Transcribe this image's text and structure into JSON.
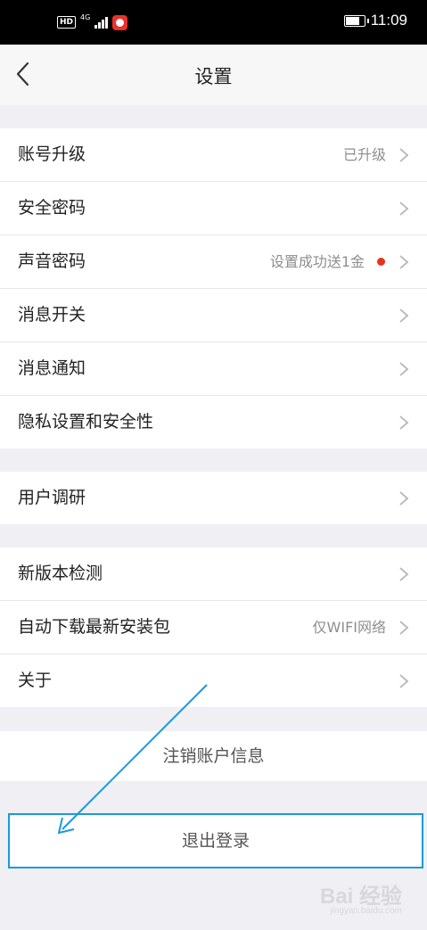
{
  "status_bar": {
    "hd": "HD",
    "network": "4G",
    "time": "11:09",
    "battery_level": 0.7
  },
  "header": {
    "title": "设置"
  },
  "groups": {
    "account": [
      {
        "label": "账号升级",
        "value": "已升级"
      },
      {
        "label": "安全密码",
        "value": ""
      },
      {
        "label": "声音密码",
        "value": "设置成功送1金",
        "has_dot": true
      },
      {
        "label": "消息开关",
        "value": ""
      },
      {
        "label": "消息通知",
        "value": ""
      },
      {
        "label": "隐私设置和安全性",
        "value": ""
      }
    ],
    "research": [
      {
        "label": "用户调研",
        "value": ""
      }
    ],
    "app": [
      {
        "label": "新版本检测",
        "value": ""
      },
      {
        "label": "自动下载最新安装包",
        "value": "仅WIFI网络"
      },
      {
        "label": "关于",
        "value": ""
      }
    ]
  },
  "actions": {
    "deregister": "注销账户信息",
    "logout": "退出登录"
  },
  "annotation_color": "#1a9ad8",
  "dot_color": "#e8331c",
  "watermark": {
    "main": "Bai 经验",
    "sub": "jingyan.baidu.com"
  }
}
